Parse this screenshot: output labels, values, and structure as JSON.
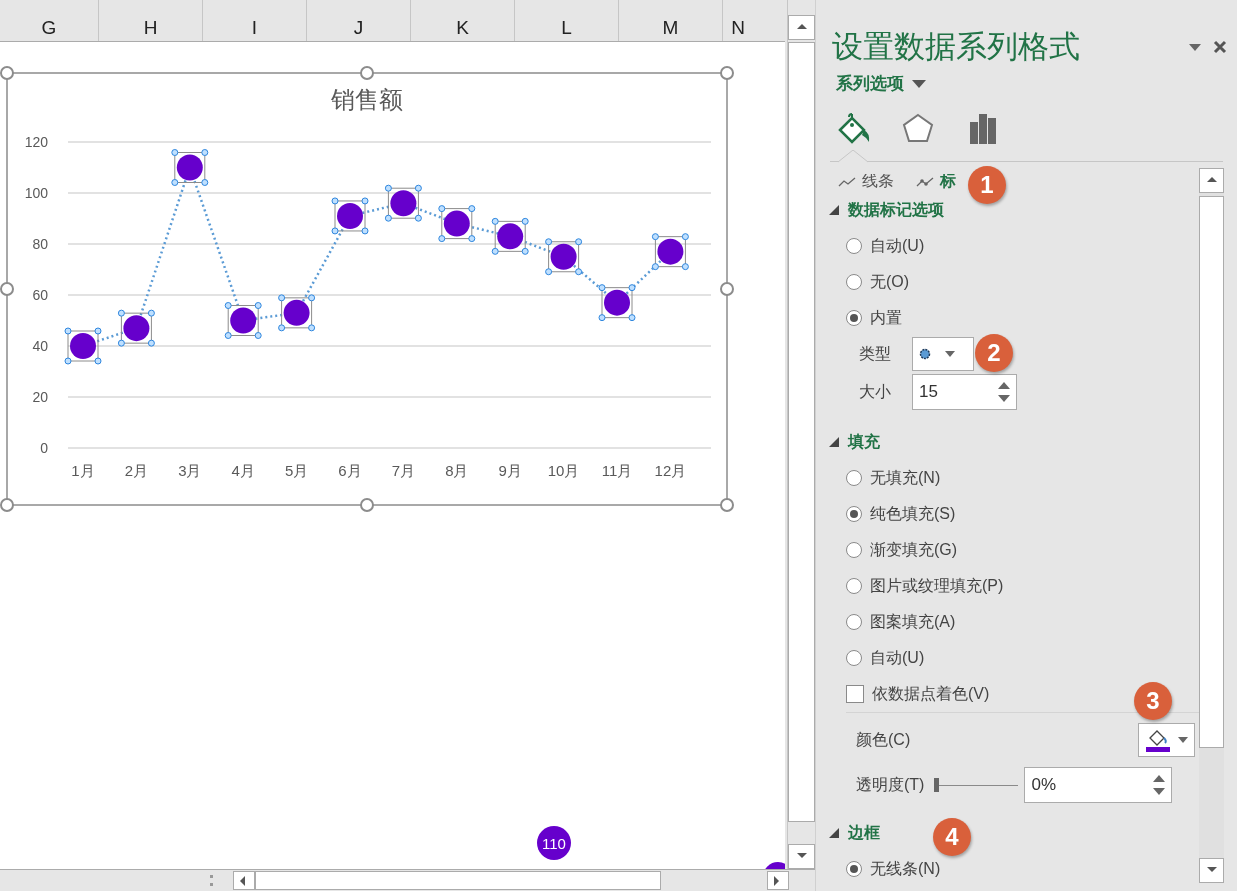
{
  "sheet": {
    "columns": [
      "G",
      "H",
      "I",
      "J",
      "K",
      "L",
      "M",
      "N"
    ],
    "chart": {
      "selected": true,
      "chart_data": {
        "type": "line",
        "title": "销售额",
        "categories": [
          "1月",
          "2月",
          "3月",
          "4月",
          "5月",
          "6月",
          "7月",
          "8月",
          "9月",
          "10月",
          "11月",
          "12月"
        ],
        "ylim": [
          0,
          120
        ],
        "yticks": [
          0,
          20,
          40,
          60,
          80,
          100,
          120
        ],
        "grid": true,
        "series": [
          {
            "color": "#6600cc",
            "line_style": "dotted",
            "marker": "circle",
            "values": [
              40,
              47,
              110,
              50,
              53,
              91,
              96,
              88,
              83,
              75,
              57,
              77
            ]
          }
        ]
      }
    },
    "stray_marker": {
      "label": "110",
      "color": "#6600cc"
    }
  },
  "pane": {
    "title": "设置数据系列格式",
    "options_menu": "系列选项",
    "icon_tabs": [
      {
        "kind": "fill",
        "selected": true
      },
      {
        "kind": "effects",
        "selected": false
      },
      {
        "kind": "series",
        "selected": false
      }
    ],
    "sub_tabs": [
      {
        "kind": "line",
        "label": "线条",
        "selected": false
      },
      {
        "kind": "marker",
        "label": "标",
        "selected": true
      }
    ],
    "sections": [
      {
        "title": "数据标记选项",
        "expanded": true,
        "items": [
          {
            "kind": "radio",
            "label": "自动(U)",
            "selected": false
          },
          {
            "kind": "radio",
            "label": "无(O)",
            "selected": false
          },
          {
            "kind": "radio",
            "label": "内置",
            "selected": true
          },
          {
            "kind": "dropdown",
            "label": "类型"
          },
          {
            "kind": "spin",
            "label": "大小",
            "value": "15"
          }
        ]
      },
      {
        "title": "填充",
        "expanded": true,
        "items": [
          {
            "kind": "radio",
            "label": "无填充(N)",
            "selected": false
          },
          {
            "kind": "radio",
            "label": "纯色填充(S)",
            "selected": true
          },
          {
            "kind": "radio",
            "label": "渐变填充(G)",
            "selected": false
          },
          {
            "kind": "radio",
            "label": "图片或纹理填充(P)",
            "selected": false
          },
          {
            "kind": "radio",
            "label": "图案填充(A)",
            "selected": false
          },
          {
            "kind": "radio",
            "label": "自动(U)",
            "selected": false
          },
          {
            "kind": "checkbox",
            "label": "依数据点着色(V)",
            "checked": false
          },
          {
            "kind": "color",
            "label": "颜色(C)",
            "color": "#6600cc"
          },
          {
            "kind": "slider",
            "label": "透明度(T)",
            "level": 0,
            "value": "0%"
          }
        ]
      },
      {
        "title": "边框",
        "expanded": true,
        "items": [
          {
            "kind": "radio",
            "label": "无线条(N)",
            "selected": true
          }
        ]
      }
    ],
    "callouts": [
      "1",
      "2",
      "3",
      "4"
    ]
  }
}
